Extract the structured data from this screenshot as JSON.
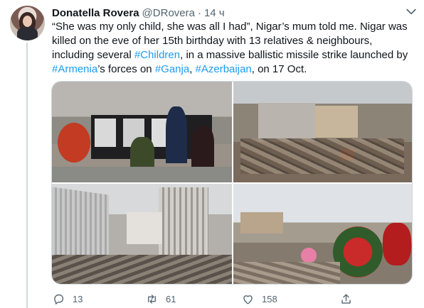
{
  "tweet": {
    "author_name": "Donatella Rovera",
    "author_handle": "@DRovera",
    "separator": "·",
    "time": "14 ч",
    "text_parts": {
      "t1": "“She was my only child, she was all I had”, Nigar’s mum told me. Nigar was killed on the eve of her 15th birthday with 13 relatives & neighbours, including several ",
      "h1": "#Children",
      "t2": ", in a massive ballistic missile strike launched by ",
      "h2": "#Armenia",
      "t3": "’s forces on ",
      "h3": "#Ganja",
      "t4": ", ",
      "h4": "#Azerbaijan",
      "t5": ", on 17 Oct."
    }
  },
  "actions": {
    "reply_count": "13",
    "retweet_count": "61",
    "like_count": "158"
  },
  "colors": {
    "link": "#1d9bf0",
    "text": "#0f1419",
    "muted": "#536471",
    "border": "#cfd9de"
  },
  "icons": [
    "chevron-down-icon",
    "reply-icon",
    "retweet-icon",
    "like-icon",
    "share-icon"
  ]
}
